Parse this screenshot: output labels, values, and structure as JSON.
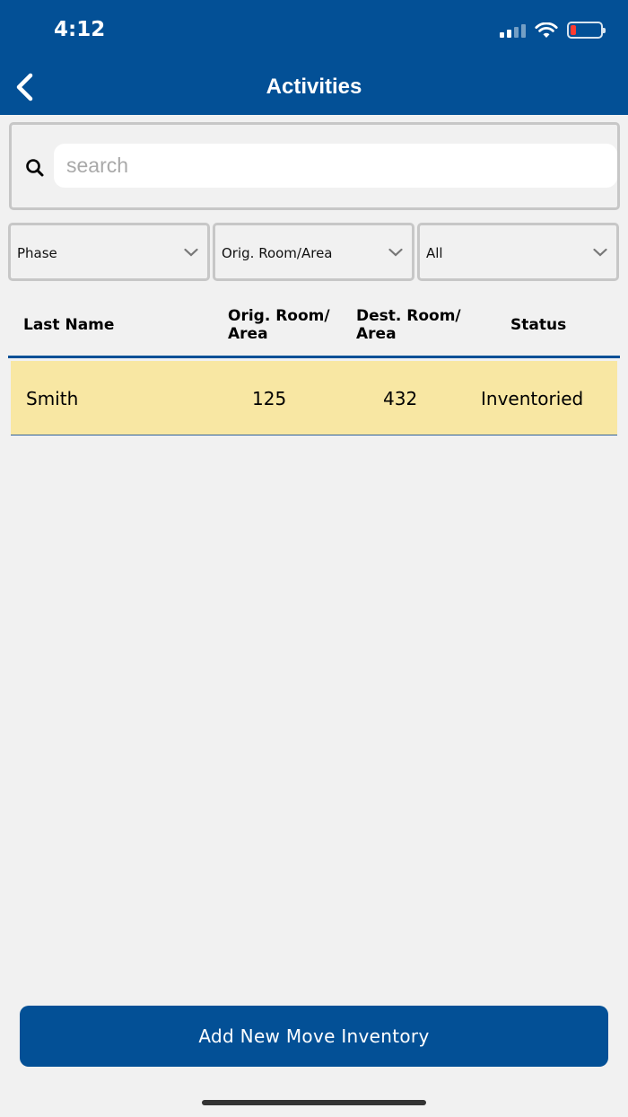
{
  "status_bar": {
    "time": "4:12",
    "icons": [
      "cellular-signal-icon",
      "wifi-icon",
      "battery-low-icon"
    ]
  },
  "header": {
    "title": "Activities",
    "back_icon": "chevron-left-icon"
  },
  "search": {
    "placeholder": "search",
    "value": "",
    "icon": "search-icon"
  },
  "filters": [
    {
      "label": "Phase",
      "icon": "chevron-down-icon"
    },
    {
      "label": "Orig. Room/Area",
      "icon": "chevron-down-icon"
    },
    {
      "label": "All",
      "icon": "chevron-down-icon"
    }
  ],
  "table": {
    "columns": [
      {
        "line1": "Last Name",
        "line2": ""
      },
      {
        "line1": "Orig. Room/",
        "line2": "Area"
      },
      {
        "line1": "Dest. Room/",
        "line2": "Area"
      },
      {
        "line1": "Status",
        "line2": ""
      }
    ],
    "rows": [
      {
        "last_name": "Smith",
        "orig_room": "125",
        "dest_room": "432",
        "status": "Inventoried"
      }
    ]
  },
  "footer": {
    "add_button_label": "Add New Move Inventory"
  },
  "colors": {
    "primary": "#035096",
    "row_highlight": "#f8e7a3",
    "background": "#f1f1f1",
    "battery_low": "#ff3b30"
  }
}
